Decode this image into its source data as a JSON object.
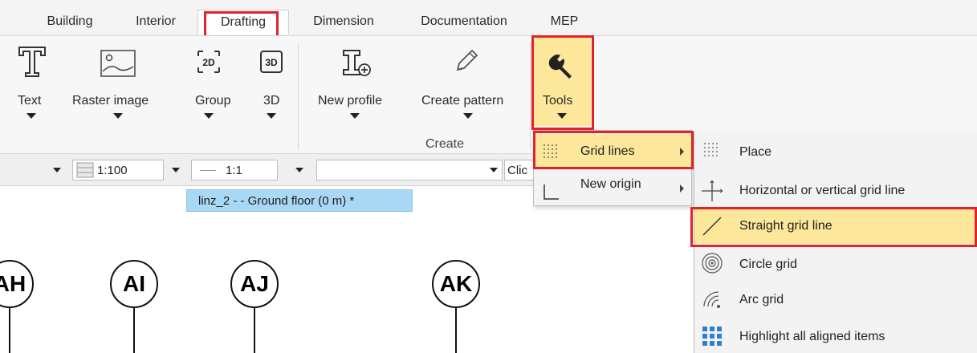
{
  "tabs": [
    {
      "label": "Building"
    },
    {
      "label": "Interior"
    },
    {
      "label": "Drafting"
    },
    {
      "label": "Dimension"
    },
    {
      "label": "Documentation"
    },
    {
      "label": "MEP"
    }
  ],
  "active_tab": "Drafting",
  "ribbon": {
    "text": "Text",
    "raster_image": "Raster image",
    "group": "Group",
    "group_icon": "2D",
    "d3": "3D",
    "d3_icon": "3D",
    "new_profile": "New profile",
    "create_pattern": "Create pattern",
    "tools": "Tools",
    "create_group": "Create"
  },
  "toolbar": {
    "scale": "1:100",
    "ratio": "1:1",
    "text_field": "",
    "clipped": "Clic"
  },
  "document_tab": "linz_2 -  - Ground floor (0 m) *",
  "grid_bubbles": [
    "AH",
    "AI",
    "AJ",
    "AK"
  ],
  "tools_menu": {
    "items": [
      {
        "label": "Grid lines",
        "icon": "dotted-grid-icon",
        "has_submenu": true
      },
      {
        "label": "New origin",
        "icon": "origin-axes-icon",
        "has_submenu": true
      }
    ]
  },
  "grid_lines_submenu": {
    "items": [
      {
        "label": "Place",
        "icon": "dotted-grid-icon"
      },
      {
        "label": "Horizontal or vertical grid line",
        "icon": "crosshair-icon"
      },
      {
        "label": "Straight grid line",
        "icon": "diagonal-line-icon"
      },
      {
        "label": "Circle grid",
        "icon": "concentric-circles-icon"
      },
      {
        "label": "Arc grid",
        "icon": "arc-grid-icon"
      },
      {
        "label": "Highlight all aligned items",
        "icon": "blue-grid-icon"
      }
    ]
  },
  "colors": {
    "highlight": "#fce79a",
    "callout": "#e0242c",
    "doc_tab": "#a9d8f5"
  }
}
